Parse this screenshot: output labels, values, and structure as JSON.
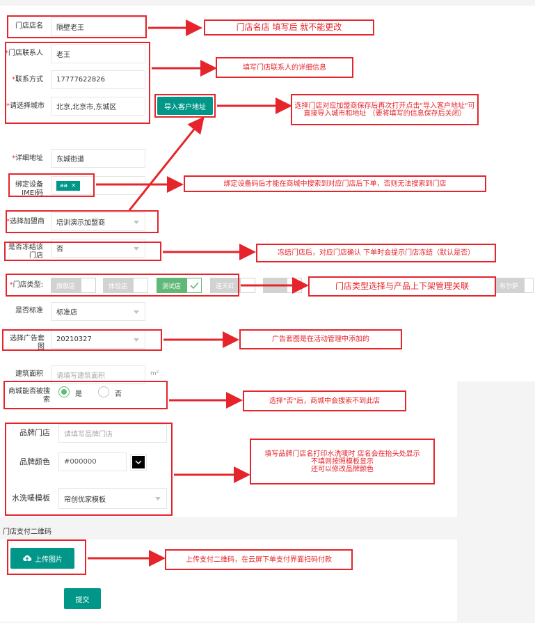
{
  "form": {
    "store_name_label": "门店店名",
    "store_name_value": "隔壁老王",
    "contact_label": "门店联系人",
    "contact_value": "老王",
    "phone_label": "联系方式",
    "phone_value": "17777622826",
    "city_label": "请选择城市",
    "city_value": "北京,北京市,东城区",
    "import_address_button": "导入客户地址",
    "address_label": "详细地址",
    "address_value": "东城街道",
    "device_label": "绑定设备IMEI码",
    "device_tag": "aa",
    "franchisee_label": "选择加盟商",
    "franchisee_value": "培训演示加盟商",
    "freeze_label": "是否冻结该门店",
    "freeze_value": "否",
    "store_type_label": "门店类型:",
    "store_types": [
      "旗舰店",
      "体验店",
      "测试店",
      "连天红",
      "",
      "",
      "",
      "布尔萨"
    ],
    "standard_label": "是否标准",
    "standard_value": "标准店",
    "ad_label": "选择广告套图",
    "ad_value": "20210327",
    "area_label": "建筑面积",
    "area_placeholder": "请填写建筑面积",
    "area_unit": "m²",
    "searchable_label": "商城能否被搜索",
    "searchable_yes": "是",
    "searchable_no": "否",
    "brand_store_label": "品牌门店",
    "brand_store_placeholder": "请填写品牌门店",
    "brand_color_label": "品牌颜色",
    "brand_color_value": "#000000",
    "wash_template_label": "水洗唛模板",
    "wash_template_value": "帘创优家模板",
    "payment_qr_label": "门店支付二维码",
    "upload_button": "上传图片",
    "submit_button": "提交"
  },
  "notes": {
    "store_name": "门店名店 填写后 就不能更改",
    "contact": "填写门店联系人的详细信息",
    "import_address": "选择门店对应加盟商保存后再次打开点击\"导入客户地址\"可直接导入城市和地址 （要将填写的信息保存后关闭）",
    "device": "绑定设备码后才能在商城中搜索到对应门店后下单，否则无法搜索到门店",
    "freeze": "冻结门店后，对应门店确认 下单时会提示门店冻结（默认是否）",
    "store_type": "门店类型选择与产品上下架管理关联",
    "ad": "广告套图是在活动管理中添加的",
    "searchable": "选择\"否\"后，商城中会搜索不到此店",
    "brand": "填写品牌门店名打印水洗唛时 店名会在抬头处显示\n不填则按照模板显示\n还可以修改品牌颜色",
    "upload": "上传支付二维码，在云屏下单支付界面扫码付款"
  },
  "colors": {
    "accent": "#009688",
    "annotation": "#e5242b",
    "checked": "#5fb878"
  }
}
